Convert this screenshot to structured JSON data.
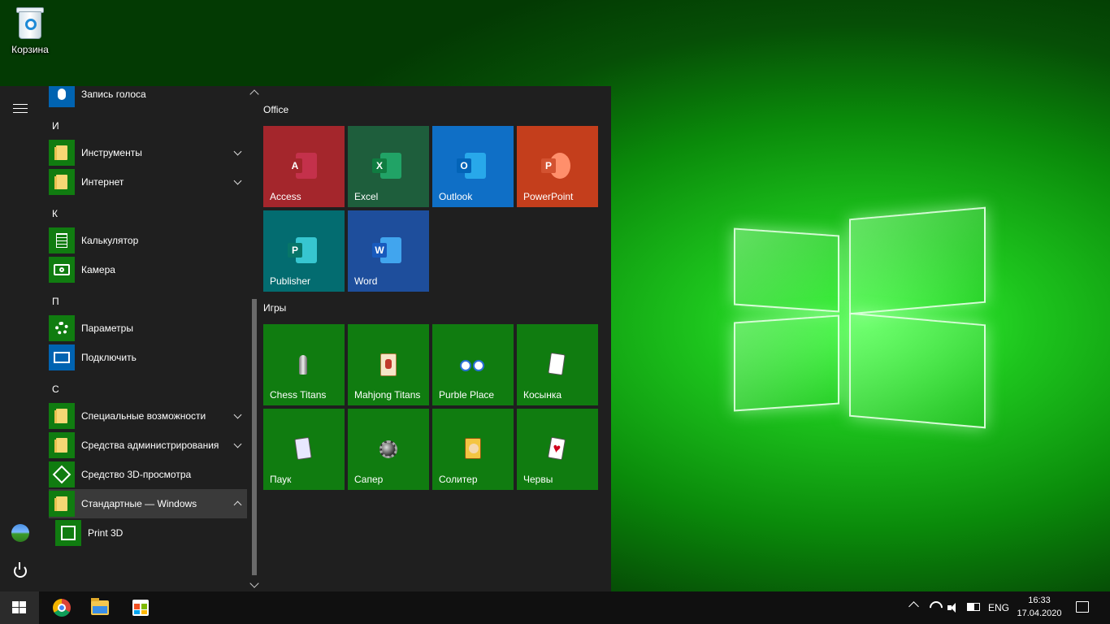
{
  "desktop": {
    "recycle_bin_label": "Корзина"
  },
  "start_menu": {
    "app_list": [
      {
        "type": "app",
        "label": "Запись голоса",
        "icon": "voice-recorder-icon"
      },
      {
        "type": "letter",
        "label": "И"
      },
      {
        "type": "folder",
        "label": "Инструменты",
        "icon": "folder-icon",
        "expanded": false
      },
      {
        "type": "folder",
        "label": "Интернет",
        "icon": "folder-icon",
        "expanded": false
      },
      {
        "type": "letter",
        "label": "К"
      },
      {
        "type": "app",
        "label": "Калькулятор",
        "icon": "calculator-icon"
      },
      {
        "type": "app",
        "label": "Камера",
        "icon": "camera-icon"
      },
      {
        "type": "letter",
        "label": "П"
      },
      {
        "type": "app",
        "label": "Параметры",
        "icon": "gear-icon"
      },
      {
        "type": "app",
        "label": "Подключить",
        "icon": "connect-icon"
      },
      {
        "type": "letter",
        "label": "С"
      },
      {
        "type": "folder",
        "label": "Специальные возможности",
        "icon": "folder-icon",
        "expanded": false
      },
      {
        "type": "folder",
        "label": "Средства администрирования",
        "icon": "folder-icon",
        "expanded": false
      },
      {
        "type": "app",
        "label": "Средство 3D-просмотра",
        "icon": "3d-viewer-icon"
      },
      {
        "type": "folder",
        "label": "Стандартные — Windows",
        "icon": "folder-icon",
        "expanded": true
      },
      {
        "type": "app",
        "label": "Print 3D",
        "icon": "print-3d-icon"
      }
    ],
    "groups": [
      {
        "title": "Office",
        "tiles": [
          {
            "label": "Access",
            "color": "#a4262c",
            "letter": "A",
            "accent": "#c4314b"
          },
          {
            "label": "Excel",
            "color": "#1e5e3c",
            "letter": "X",
            "accent": "#107c41"
          },
          {
            "label": "Outlook",
            "color": "#0f6fc6",
            "letter": "O",
            "accent": "#0364b8"
          },
          {
            "label": "PowerPoint",
            "color": "#c43e1c",
            "letter": "P",
            "accent": "#d35230"
          },
          {
            "label": "Publisher",
            "color": "#036c70",
            "letter": "P",
            "accent": "#077568"
          },
          {
            "label": "Word",
            "color": "#1e4e9c",
            "letter": "W",
            "accent": "#185abd"
          }
        ]
      },
      {
        "title": "Игры",
        "tiles": [
          {
            "label": "Chess Titans",
            "icon": "chess-icon"
          },
          {
            "label": "Mahjong Titans",
            "icon": "mahjong-icon"
          },
          {
            "label": "Purble Place",
            "icon": "purble-eyes-icon"
          },
          {
            "label": "Косынка",
            "icon": "solitaire-cards-icon"
          },
          {
            "label": "Паук",
            "icon": "spider-solitaire-icon"
          },
          {
            "label": "Сапер",
            "icon": "minesweeper-icon"
          },
          {
            "label": "Солитер",
            "icon": "freecell-king-icon"
          },
          {
            "label": "Червы",
            "icon": "hearts-icon"
          }
        ]
      }
    ]
  },
  "taskbar": {
    "apps": [
      "chrome-icon",
      "file-explorer-icon",
      "store-icon"
    ],
    "language": "ENG",
    "time": "16:33",
    "date": "17.04.2020"
  }
}
